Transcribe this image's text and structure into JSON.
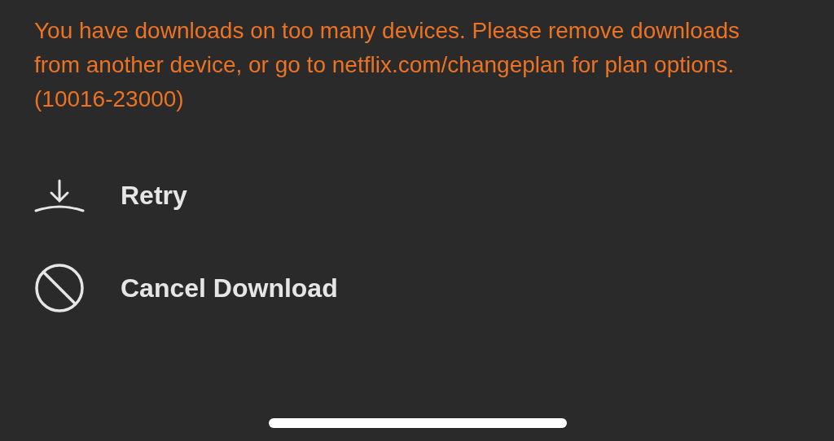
{
  "message": "You have downloads on too many devices. Please remove downloads from another device, or go to netflix.com/changeplan for plan options. (10016-23000)",
  "actions": [
    {
      "kind": "download",
      "label": "Retry"
    },
    {
      "kind": "cancel",
      "label": "Cancel Download"
    }
  ]
}
